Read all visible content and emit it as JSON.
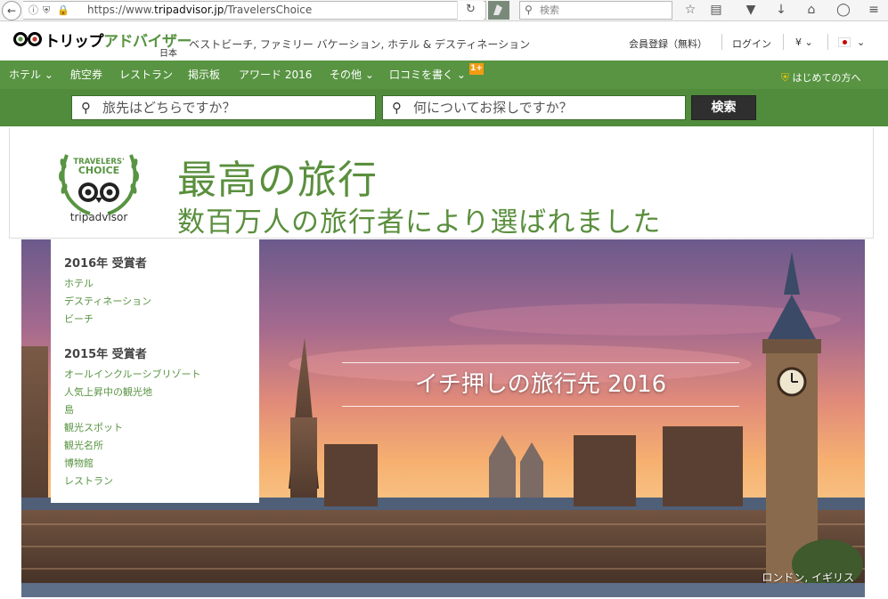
{
  "browser": {
    "url_prefix": "https://www.",
    "url_domain": "tripadvisor.jp",
    "url_path": "/TravelersChoice",
    "search_placeholder": "検索"
  },
  "header": {
    "brand_black": "トリップ",
    "brand_green": "アドバイザー",
    "country": "日本",
    "tagline": "ベストビーチ, ファミリー バケーション, ホテル & デスティネーション",
    "register": "会員登録（無料）",
    "login": "ログイン",
    "currency": "¥"
  },
  "nav": {
    "items": [
      {
        "label": "ホテル ⌄"
      },
      {
        "label": "航空券"
      },
      {
        "label": "レストラン"
      },
      {
        "label": "掲示板"
      },
      {
        "label": "アワード 2016"
      },
      {
        "label": "その他 ⌄"
      },
      {
        "label": "口コミを書く ⌄"
      }
    ],
    "badge": "1+",
    "first_time": "はじめての方へ"
  },
  "search": {
    "where_placeholder": "旅先はどちらですか？",
    "what_placeholder": "何についてお探しですか？",
    "button": "検索"
  },
  "banner": {
    "badge_line1": "TRAVELERS'",
    "badge_line2": "CHOICE",
    "badge_brand": "tripadvisor",
    "title": "最高の旅行",
    "subtitle": "数百万人の旅行者により選ばれました"
  },
  "awards": {
    "y2016_heading": "2016年 受賞者",
    "y2016_links": [
      "ホテル",
      "デスティネーション",
      "ビーチ"
    ],
    "y2015_heading": "2015年 受賞者",
    "y2015_links": [
      "オールインクルーシブリゾート",
      "人気上昇中の観光地",
      "島",
      "観光スポット",
      "観光名所",
      "博物館",
      "レストラン"
    ]
  },
  "hero": {
    "title": "イチ押しの旅行先 2016",
    "caption": "ロンドン, イギリス"
  },
  "colors": {
    "brand_green": "#589442",
    "nav_green": "#589442",
    "search_green": "#508c3c"
  }
}
